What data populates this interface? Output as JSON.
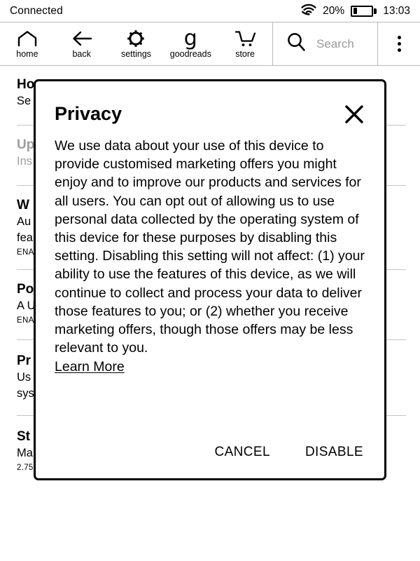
{
  "status_bar": {
    "connection": "Connected",
    "wifi_icon": "wifi-icon",
    "battery_percent": "20%",
    "battery_level": 20,
    "time": "13:03"
  },
  "toolbar": {
    "items": [
      {
        "label": "home",
        "icon": "home-icon"
      },
      {
        "label": "back",
        "icon": "back-arrow-icon"
      },
      {
        "label": "settings",
        "icon": "gear-icon"
      },
      {
        "label": "goodreads",
        "icon": "goodreads-g-icon"
      },
      {
        "label": "store",
        "icon": "shopping-cart-icon"
      }
    ],
    "search": {
      "placeholder": "Search",
      "icon": "search-icon",
      "value": ""
    },
    "overflow": {
      "icon": "kebab-menu-icon"
    }
  },
  "settings_list": [
    {
      "title": "Ho",
      "subtitle": "Se",
      "meta": "",
      "dimmed": false
    },
    {
      "title": "Up",
      "subtitle": "Ins",
      "meta": "",
      "dimmed": true
    },
    {
      "title": "W",
      "subtitle": "Au",
      "subtitle2": "fea",
      "meta": "ENA",
      "dimmed": false
    },
    {
      "title": "Po",
      "subtitle": "A U",
      "meta": "ENA",
      "dimmed": false
    },
    {
      "title": "Pr",
      "subtitle": "Us",
      "subtitle2": "sys",
      "meta": "",
      "dimmed": false
    },
    {
      "title": "St",
      "subtitle": "Ma",
      "meta": "2.75",
      "dimmed": false
    }
  ],
  "dialog": {
    "title": "Privacy",
    "close_icon": "close-x-icon",
    "body": "We use data about your use of this device to provide customised marketing offers you might enjoy and to improve our products and services for all users. You can opt out of allowing us to use personal data collected by the operating system of this device for these purposes by disabling this setting. Disabling this setting will not affect: (1) your ability to use the features of this device, as we will continue to collect and process your data to deliver those features to you; or (2) whether you receive marketing offers, though those offers may be less relevant to you.",
    "learn_more": "Learn More",
    "cancel_label": "CANCEL",
    "disable_label": "DISABLE"
  },
  "colors": {
    "text": "#000000",
    "muted": "#9a9a9a",
    "divider": "#c4c4c4",
    "background": "#ffffff"
  }
}
